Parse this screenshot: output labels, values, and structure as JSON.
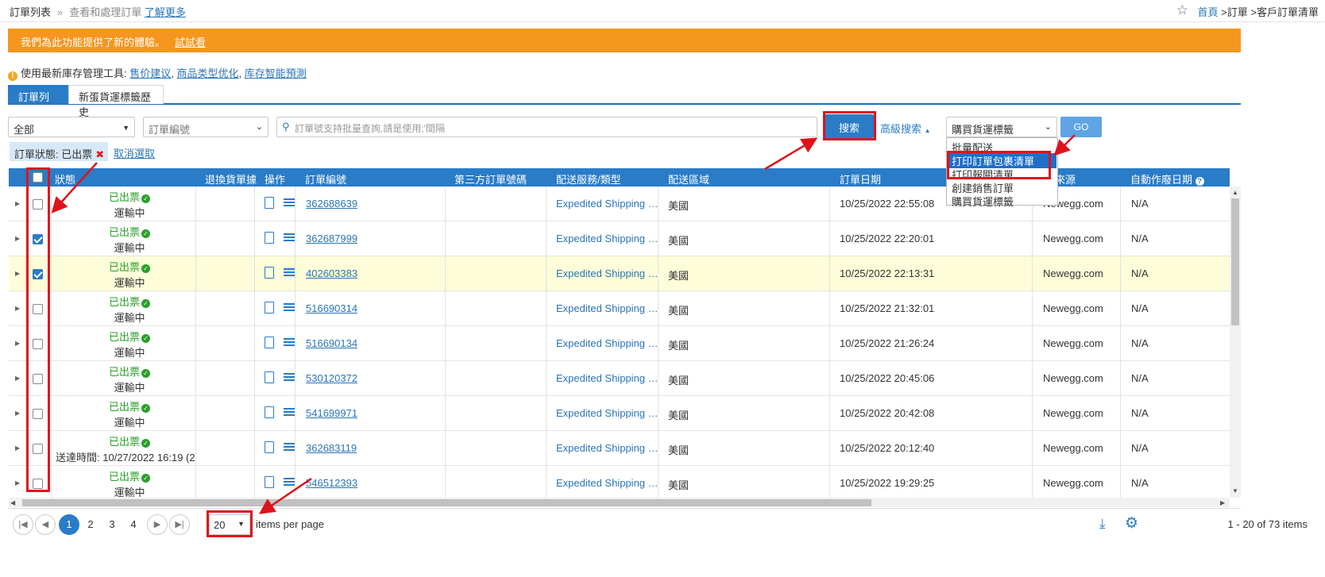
{
  "breadcrumb_left": {
    "title": "訂單列表",
    "separator": "»",
    "subtitle": "查看和處理訂單",
    "learn_more": "了解更多"
  },
  "breadcrumb_right": {
    "home": "首頁",
    "sep1": ">",
    "orders": "訂單",
    "sep2": ">",
    "current": "客戶訂單清單"
  },
  "banner": {
    "text": "我們為此功能提供了新的體驗。",
    "try_link": "試試看",
    "color": "#f5961e"
  },
  "tools": {
    "label": "使用最新庫存管理工具:",
    "links": [
      "售价建议",
      "商品类型优化",
      "库存智能預測"
    ],
    "comma": ","
  },
  "tabs": [
    {
      "label": "訂單列表",
      "active": true
    },
    {
      "label": "新蛋貨運標籤歷史",
      "active": false
    }
  ],
  "filters": {
    "status_select": "全部",
    "field_select": "訂單編號",
    "search_placeholder": "訂單號支持批量查詢,請是使用;'間隔",
    "search_button": "搜索",
    "advanced": "高級搜索",
    "action_select": "購買貨運標籤",
    "go": "GO"
  },
  "action_menu": [
    "批量配送",
    "打印訂單包裹清單",
    "打印報關清單",
    "創建銷售訂單",
    "購買貨運標籤"
  ],
  "active_filter": {
    "label": "訂單狀態:",
    "value": "已出票",
    "cancel": "取消選取"
  },
  "columns": [
    "狀態",
    "退換貨單據",
    "操作",
    "訂單編號",
    "第三方訂單號碼",
    "配送服務/類型",
    "配送區域",
    "訂單日期",
    "來源",
    "自動作廢日期"
  ],
  "rows": [
    {
      "status": "已出票",
      "sub": "運輸中",
      "order": "362688639",
      "ship": "Expedited Shipping (3-...",
      "zone": "美國",
      "date": "10/25/2022 22:55:08",
      "source": "Newegg.com",
      "auto": "N/A",
      "checked": false,
      "highlight": false
    },
    {
      "status": "已出票",
      "sub": "運輸中",
      "order": "362687999",
      "ship": "Expedited Shipping (3-...",
      "zone": "美國",
      "date": "10/25/2022 22:20:01",
      "source": "Newegg.com",
      "auto": "N/A",
      "checked": true,
      "highlight": false
    },
    {
      "status": "已出票",
      "sub": "運輸中",
      "order": "402603383",
      "ship": "Expedited Shipping (3-...",
      "zone": "美國",
      "date": "10/25/2022 22:13:31",
      "source": "Newegg.com",
      "auto": "N/A",
      "checked": true,
      "highlight": true
    },
    {
      "status": "已出票",
      "sub": "運輸中",
      "order": "516690314",
      "ship": "Expedited Shipping (3-...",
      "zone": "美國",
      "date": "10/25/2022 21:32:01",
      "source": "Newegg.com",
      "auto": "N/A",
      "checked": false,
      "highlight": false
    },
    {
      "status": "已出票",
      "sub": "運輸中",
      "order": "516690134",
      "ship": "Expedited Shipping (3-...",
      "zone": "美國",
      "date": "10/25/2022 21:26:24",
      "source": "Newegg.com",
      "auto": "N/A",
      "checked": false,
      "highlight": false
    },
    {
      "status": "已出票",
      "sub": "運輸中",
      "order": "530120372",
      "ship": "Expedited Shipping (3-...",
      "zone": "美國",
      "date": "10/25/2022 20:45:06",
      "source": "Newegg.com",
      "auto": "N/A",
      "checked": false,
      "highlight": false
    },
    {
      "status": "已出票",
      "sub": "運輸中",
      "order": "541699971",
      "ship": "Expedited Shipping (3-...",
      "zone": "美國",
      "date": "10/25/2022 20:42:08",
      "source": "Newegg.com",
      "auto": "N/A",
      "checked": false,
      "highlight": false
    },
    {
      "status": "已出票",
      "sub": "送達時間:  10/27/2022 16:19 (2",
      "order": "362683119",
      "ship": "Expedited Shipping (3-...",
      "zone": "美國",
      "date": "10/25/2022 20:12:40",
      "source": "Newegg.com",
      "auto": "N/A",
      "checked": false,
      "highlight": false
    },
    {
      "status": "已出票",
      "sub": "運輸中",
      "order": "546512393",
      "ship": "Expedited Shipping (3-...",
      "zone": "美國",
      "date": "10/25/2022 19:29:25",
      "source": "Newegg.com",
      "auto": "N/A",
      "checked": false,
      "highlight": false
    }
  ],
  "pager": {
    "pages": [
      "1",
      "2",
      "3",
      "4"
    ],
    "current": "1",
    "per_page": "20",
    "per_page_label": "items per page",
    "count": "1 - 20 of 73 items"
  },
  "colors": {
    "primary": "#2a7cc7",
    "annotation": "#e0121c",
    "success": "#2aa02a"
  }
}
